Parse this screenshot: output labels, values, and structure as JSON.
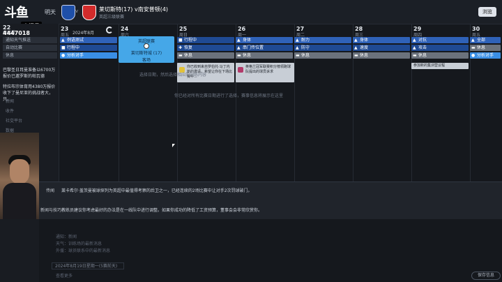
{
  "header": {
    "logo": "斗鱼",
    "room_tag": "房间号",
    "day_label": "明天",
    "vs": "v",
    "match_title": "莱切斯特(17) v南安普顿(4)",
    "match_sub": "英超三级联赛",
    "browse_btn": "浏览",
    "month_label": "2024年8月",
    "home_crest_color": "#1e4fa8",
    "away_crest_color": "#d22b2b"
  },
  "left_panel": {
    "room_label": "房间号",
    "room_number": "4447018",
    "day_num": "22",
    "rows": [
      "通知天气推送",
      "自动比赛",
      "休息"
    ],
    "chat1": "巴黎圣日耳曼准备以6700万报价已邀罗斯的帕瓦德",
    "chat2": "特拉布宗体育用4380万报价收下了曼尼亚的挑战者大，只...",
    "nav": [
      "新闻",
      "收件",
      "社交平台",
      "数据",
      "阵容",
      "比赛"
    ]
  },
  "calendar": {
    "days": [
      {
        "num": "23",
        "wk": "周五"
      },
      {
        "num": "24",
        "wk": "周六"
      },
      {
        "num": "25",
        "wk": "周日"
      },
      {
        "num": "26",
        "wk": "周一"
      },
      {
        "num": "27",
        "wk": "周二"
      },
      {
        "num": "28",
        "wk": "周三"
      },
      {
        "num": "29",
        "wk": "周四"
      },
      {
        "num": "30",
        "wk": "周五"
      }
    ],
    "col23": [
      "例语测试",
      "行程中",
      "分析对手"
    ],
    "col25": [
      "行程中",
      "恢复",
      "休息"
    ],
    "col26": [
      "身体",
      "串门传位置",
      "休息"
    ],
    "col27": [
      "耐力",
      "防守",
      "休息"
    ],
    "col28": [
      "身体",
      "速度",
      "休息"
    ],
    "col29": [
      "对抗",
      "攻击",
      "休息"
    ],
    "col30": [
      "全部",
      "休息",
      "分析对手"
    ],
    "highlight": {
      "title": "英超联赛",
      "line": "莱切斯特城 (17)",
      "foot": "客场"
    },
    "card1": "你已收到来自罗伯托·马丁内斯的邀请，希望让你在下场比赛中...",
    "card2": "英格兰冠军联赛积分榜领跑球队提出的球员诉求",
    "card3": "参加新的集训营议程",
    "hint1": "选择日期，然后选择相应的训练内容",
    "hint2": "你已经对所有比赛日期进行了选择，赛事信息将展示在这里"
  },
  "news": {
    "label1": "传闻",
    "text1": "莱卡希尔·盖茨曼被球探列为英超中最值得考察的后卫之一，已经连续的2场比赛中让对手2次罚球破门。",
    "label2": "新闻与技巧",
    "text2": "教练员建议你考虑最好的办法是在一线队中进行调整。如果你成功的降低了工资预算，董事会会非常欣赏你。"
  },
  "bottom": {
    "dim1": "通知：新闻",
    "dim2": "天气：训练场的最新消息",
    "dim3": "外援：球员联系中的最新消息",
    "date_box": "2024年8月19日星期一(5赛前天)",
    "dim4": "查看更多",
    "cont_btn": "保存信息"
  }
}
